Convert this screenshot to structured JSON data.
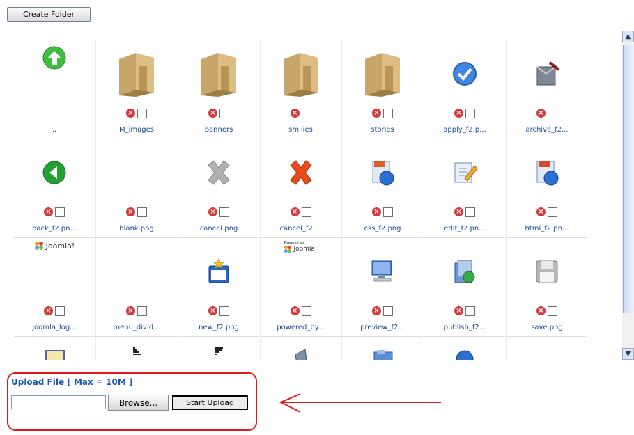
{
  "toolbar": {
    "create_folder_label": "Create Folder"
  },
  "upload": {
    "legend": "Upload File [ Max = 10M ]",
    "browse_label": "Browse...",
    "start_label": "Start Upload"
  },
  "colors": {
    "annotation_red": "#e01818",
    "link_blue": "#1a4d9c",
    "legend_blue": "#1a56b5"
  },
  "grid": {
    "rows": [
      [
        {
          "name": "..",
          "icon": "up-arrow-icon"
        },
        {
          "name": "M_images",
          "icon": "folder-icon"
        },
        {
          "name": "banners",
          "icon": "folder-icon"
        },
        {
          "name": "smilies",
          "icon": "folder-icon"
        },
        {
          "name": "stories",
          "icon": "folder-icon"
        },
        {
          "name": "apply_f2.p...",
          "icon": "checkmark-icon"
        },
        {
          "name": "archive_f2...",
          "icon": "archive-icon"
        }
      ],
      [
        {
          "name": "back_f2.pn...",
          "icon": "back-arrow-icon"
        },
        {
          "name": "blank.png",
          "icon": "blank-icon"
        },
        {
          "name": "cancel.png",
          "icon": "gray-x-icon"
        },
        {
          "name": "cancel_f2....",
          "icon": "red-x-icon"
        },
        {
          "name": "css_f2.png",
          "icon": "css-globe-icon"
        },
        {
          "name": "edit_f2.pn...",
          "icon": "edit-icon"
        },
        {
          "name": "html_f2.pn...",
          "icon": "html-globe-icon"
        }
      ],
      [
        {
          "name": "joomla_log...",
          "icon": "joomla-logo-icon"
        },
        {
          "name": "menu_divid...",
          "icon": "menu-divider-icon"
        },
        {
          "name": "new_f2.png",
          "icon": "new-icon"
        },
        {
          "name": "powered_by...",
          "icon": "powered-by-icon"
        },
        {
          "name": "preview_f2...",
          "icon": "monitor-icon"
        },
        {
          "name": "publish_f2...",
          "icon": "publish-icon"
        },
        {
          "name": "save.png",
          "icon": "floppy-icon"
        }
      ],
      [
        {
          "name": "",
          "icon": "document-icon"
        },
        {
          "name": "",
          "icon": "sort-asc-icon"
        },
        {
          "name": "",
          "icon": "sort-desc-icon"
        },
        {
          "name": "",
          "icon": "trash-icon"
        },
        {
          "name": "",
          "icon": "folder-blue-icon"
        },
        {
          "name": "",
          "icon": "globe-icon"
        },
        {
          "name": "",
          "icon": "blank-icon"
        }
      ]
    ],
    "logo_texts": {
      "joomla": "Joomla!",
      "powered_small": "Powered by",
      "joomla_small": "Joomla!"
    }
  }
}
